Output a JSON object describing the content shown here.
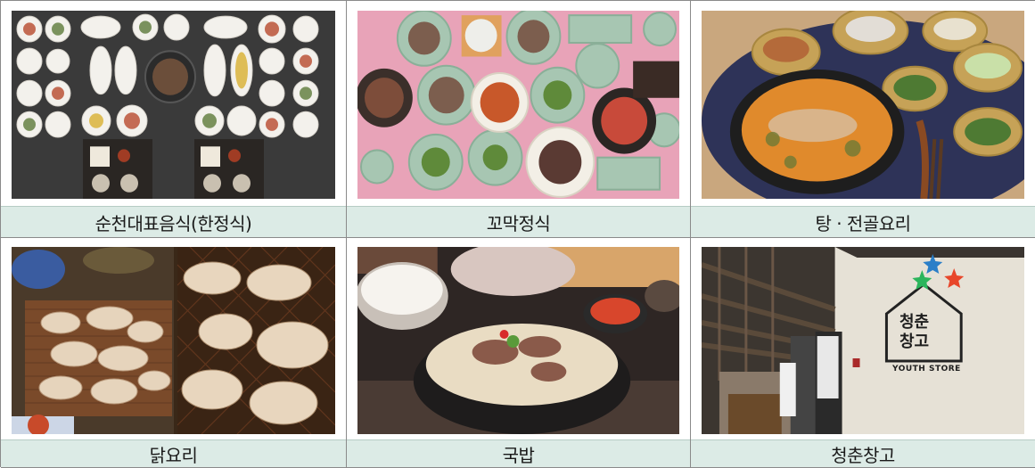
{
  "cells": [
    {
      "caption": "순천대표음식(한정식)",
      "image_description": "Top-down view of many small Korean side dishes on a dark table"
    },
    {
      "caption": "꼬막정식",
      "image_description": "Cockle set meal with various plates on pink table"
    },
    {
      "caption": "탕 · 전골요리",
      "image_description": "Spicy fish stew in black bowl with side dishes on blue mat"
    },
    {
      "caption": "닭요리",
      "image_description": "Grilled chicken pieces on wire grill"
    },
    {
      "caption": "국밥",
      "image_description": "Rice soup with sliced meat in stone bowl with rice and sauce"
    },
    {
      "caption": "청춘창고",
      "image_description": "Warehouse building exterior with 청춘창고 YOUTH STORE logo"
    }
  ],
  "logo": {
    "line1": "청춘",
    "line2": "창고",
    "sub": "YOUTH STORE"
  }
}
